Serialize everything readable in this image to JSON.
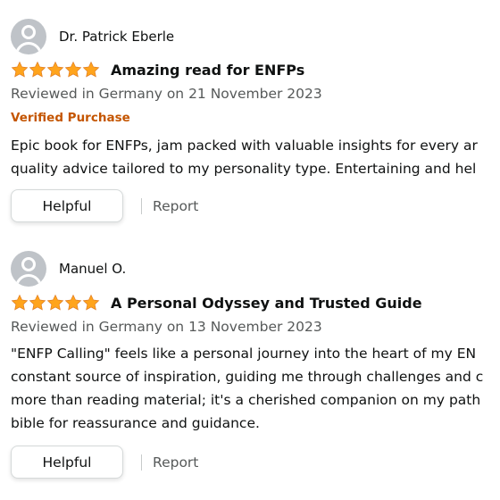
{
  "reviews": [
    {
      "reviewer": "Dr. Patrick Eberle",
      "rating": 5,
      "title": "Amazing read for ENFPs",
      "meta": "Reviewed in Germany on 21 November 2023",
      "verified": "Verified Purchase",
      "body": [
        "Epic book for ENFPs, jam packed with valuable insights for every ar",
        "quality advice tailored to my personality type. Entertaining and hel"
      ],
      "helpful_label": "Helpful",
      "report_label": "Report"
    },
    {
      "reviewer": "Manuel O.",
      "rating": 5,
      "title": "A Personal Odyssey and Trusted Guide",
      "meta": "Reviewed in Germany on 13 November 2023",
      "body": [
        "\"ENFP Calling\" feels like a personal journey into the heart of my EN",
        "constant source of inspiration, guiding me through challenges and c",
        "more than reading material; it's a cherished companion on my path",
        "bible for reassurance and guidance."
      ],
      "helpful_label": "Helpful",
      "report_label": "Report"
    }
  ],
  "colors": {
    "star": "#ffa41c",
    "verified": "#c45500",
    "meta": "#565959"
  }
}
